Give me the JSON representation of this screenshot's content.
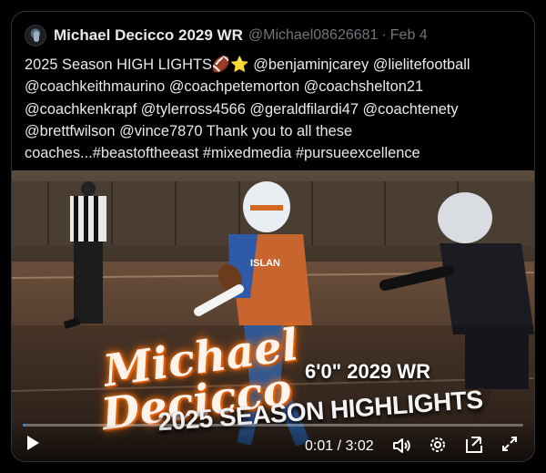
{
  "post": {
    "author_name": "Michael Decicco 2029 WR",
    "handle": "@Michael08626681",
    "separator": "·",
    "date": "Feb 4",
    "text": "2025 Season HIGH LIGHTS🏈⭐ @benjaminjcarey @lielitefootball\n@coachkeithmaurino @coachpetemorton @coachshelton21\n@coachkenkrapf @tylerross4566 @geraldfilardi47 @coachtenety\n@brettfwilson @vince7870 Thank you to all these\ncoaches...#beastoftheeast #mixedmedia #pursueexcellence"
  },
  "video": {
    "overlay_first_name": "Michael",
    "overlay_last_name": "Decicco",
    "overlay_stat": "6'0\" 2029 WR",
    "overlay_subtitle": "2025 SEASON HIGHLIGHTS",
    "player_jersey_text": "ISLAN",
    "time_display": "0:01 / 3:02",
    "progress_fraction": 0.0055,
    "icons": [
      "play-icon",
      "volume-icon",
      "settings-icon",
      "pip-icon",
      "fullscreen-icon"
    ]
  },
  "colors": {
    "background": "#000000",
    "text": "#e7e9ea",
    "muted": "#71767b",
    "border": "#2f3336",
    "accent": "#1d9bf0"
  }
}
